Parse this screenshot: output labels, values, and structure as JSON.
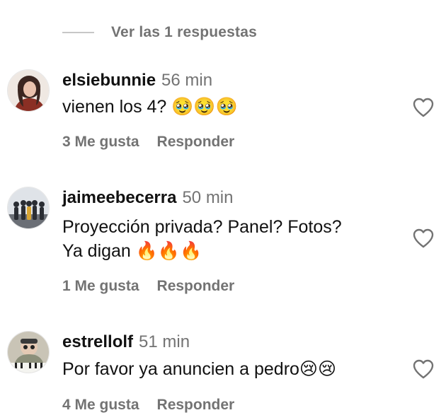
{
  "replies_toggle": {
    "label": "Ver las 1 respuestas"
  },
  "comments": [
    {
      "username": "elsiebunnie",
      "time": "56 min",
      "text": "vienen los 4? 🥹🥹🥹",
      "likes": "3 Me gusta",
      "reply": "Responder",
      "avatar_icon": "profile-photo-woman"
    },
    {
      "username": "jaimeebecerra",
      "time": "50 min",
      "text": "Proyección privada? Panel? Fotos?\nYa digan 🔥🔥🔥",
      "likes": "1 Me gusta",
      "reply": "Responder",
      "avatar_icon": "profile-photo-group"
    },
    {
      "username": "estrellolf",
      "time": "51 min",
      "text": "Por favor ya anuncien a pedro😢😢",
      "likes": "4 Me gusta",
      "reply": "Responder",
      "avatar_icon": "profile-photo-piano"
    }
  ],
  "colors": {
    "text_primary": "#111111",
    "text_secondary": "#737373",
    "divider": "#c7c7c7"
  },
  "icons": {
    "like": "heart-outline-icon"
  }
}
